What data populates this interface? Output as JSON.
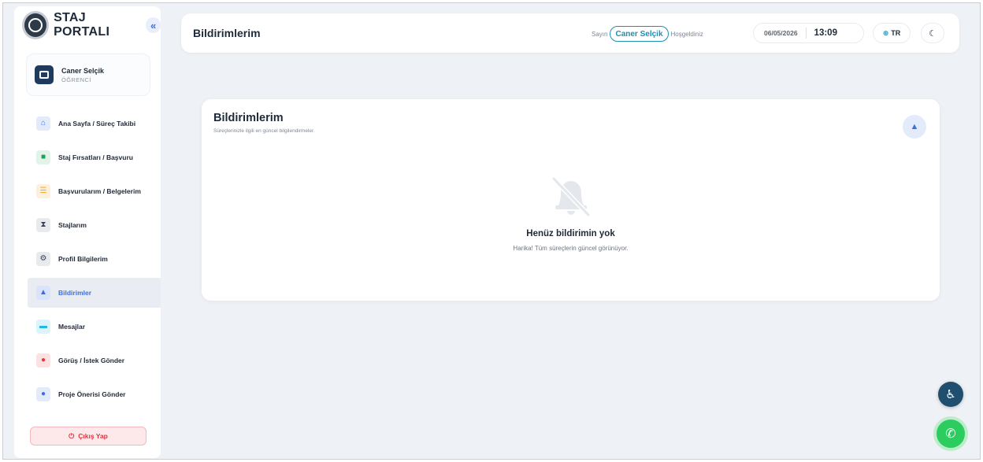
{
  "app": {
    "name": "STAJ PORTALI",
    "collapse_icon": "«"
  },
  "user": {
    "name": "Caner Selçik",
    "role": "ÖĞRENCİ"
  },
  "sidebar": {
    "items": [
      {
        "label": "Ana Sayfa / Süreç Takibi",
        "icon": "home-icon",
        "color": "#3b6fe0",
        "active": false
      },
      {
        "label": "Staj Fırsatları / Başvuru",
        "icon": "briefcase-icon",
        "color": "#22a05b",
        "active": false
      },
      {
        "label": "Başvurularım / Belgelerim",
        "icon": "list-icon",
        "color": "#f2a83a",
        "active": false
      },
      {
        "label": "Stajlarım",
        "icon": "hourglass-icon",
        "color": "#374151",
        "active": false
      },
      {
        "label": "Profil Bilgilerim",
        "icon": "user-gear-icon",
        "color": "#374151",
        "active": false
      },
      {
        "label": "Bildirimler",
        "icon": "bell-icon",
        "color": "#3b6fe0",
        "active": true
      },
      {
        "label": "Mesajlar",
        "icon": "chat-icon",
        "color": "#22b8e6",
        "active": false
      },
      {
        "label": "Görüş / İstek Gönder",
        "icon": "comments-icon",
        "color": "#e23b3b",
        "active": false
      },
      {
        "label": "Proje Önerisi Gönder",
        "icon": "lightbulb-icon",
        "color": "#3b6fe0",
        "active": false
      }
    ],
    "logout_label": "Çıkış Yap"
  },
  "header": {
    "title": "Bildirimlerim",
    "greet_prefix": "Sayın",
    "greet_name": "Caner Selçik",
    "greet_suffix": "Hoşgeldiniz",
    "date": "06/05/2026",
    "time": "13:09",
    "lang": "TR"
  },
  "card": {
    "title": "Bildirimlerim",
    "subtitle": "Süreçlerinizle ilgili en güncel bilgilendirmeler.",
    "empty_title": "Henüz bildirimin yok",
    "empty_subtitle": "Harika! Tüm süreçlerin güncel görünüyor."
  },
  "colors": {
    "accent": "#3b6fe0",
    "teal": "#1d8fb3",
    "danger": "#dc3545",
    "whatsapp": "#2dcc5f"
  }
}
